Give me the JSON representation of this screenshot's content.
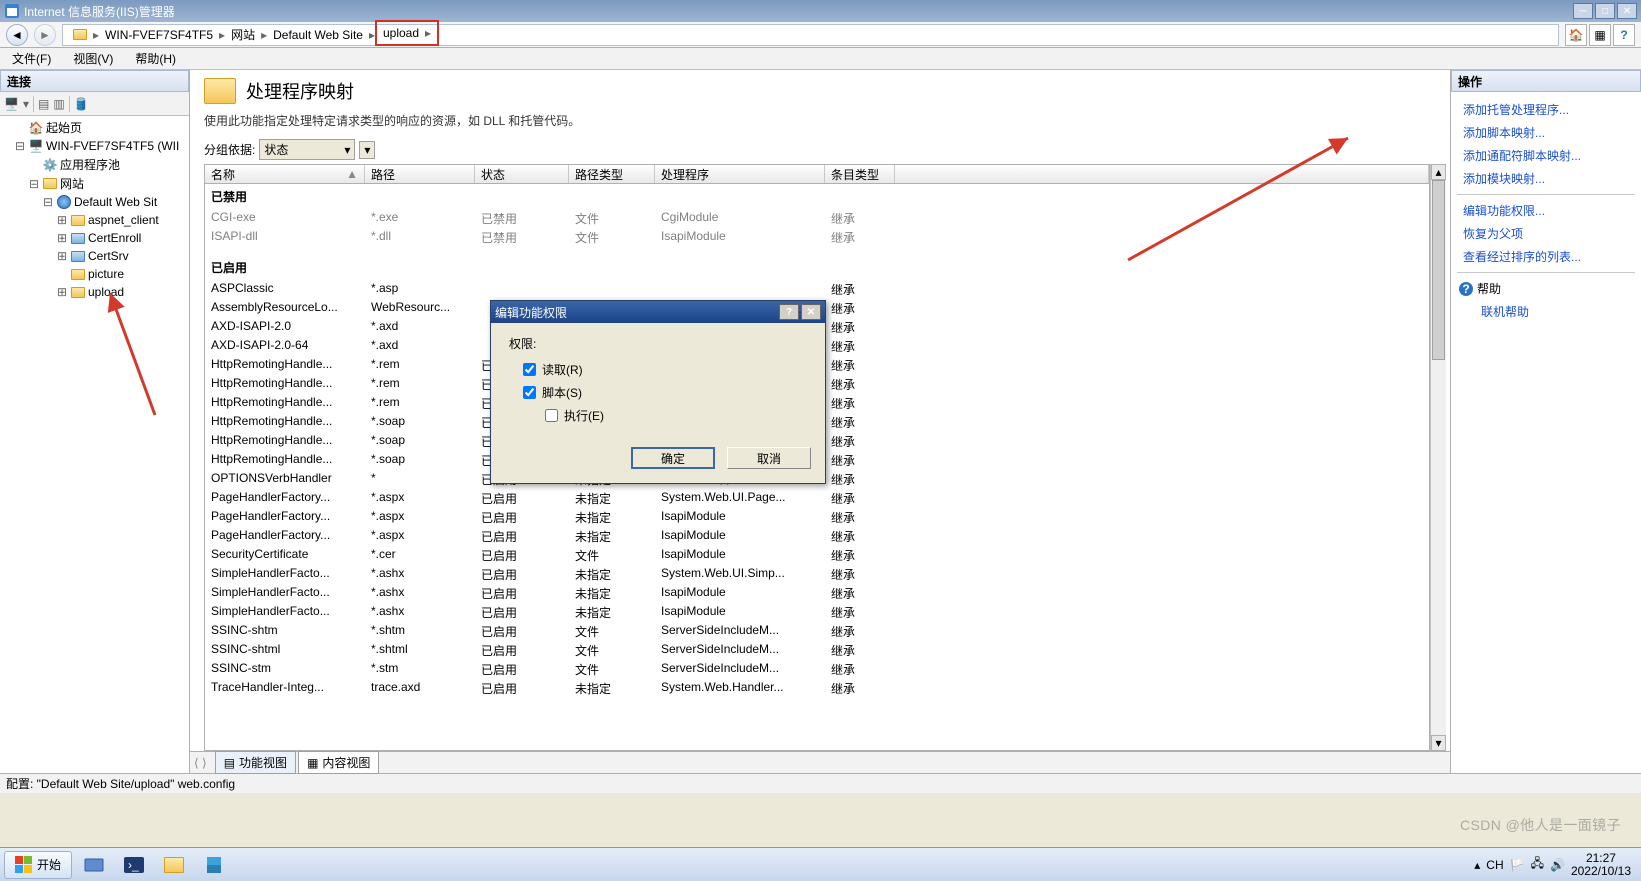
{
  "window": {
    "title": "Internet 信息服务(IIS)管理器"
  },
  "breadcrumb": {
    "items": [
      "WIN-FVEF7SF4TF5",
      "网站",
      "Default Web Site",
      "upload"
    ]
  },
  "menubar": {
    "file": "文件(F)",
    "view": "视图(V)",
    "help": "帮助(H)"
  },
  "connections": {
    "title": "连接",
    "tree": [
      {
        "label": "起始页",
        "ind": 1,
        "icon": "home"
      },
      {
        "label": "WIN-FVEF7SF4TF5 (WII",
        "ind": 1,
        "icon": "server",
        "exp": "-"
      },
      {
        "label": "应用程序池",
        "ind": 2,
        "icon": "pool"
      },
      {
        "label": "网站",
        "ind": 2,
        "icon": "folder",
        "exp": "-"
      },
      {
        "label": "Default Web Sit",
        "ind": 3,
        "icon": "globe",
        "exp": "-"
      },
      {
        "label": "aspnet_client",
        "ind": 4,
        "icon": "folder",
        "exp": "+"
      },
      {
        "label": "CertEnroll",
        "ind": 4,
        "icon": "vdir",
        "exp": "+"
      },
      {
        "label": "CertSrv",
        "ind": 4,
        "icon": "vdir",
        "exp": "+"
      },
      {
        "label": "picture",
        "ind": 4,
        "icon": "folder"
      },
      {
        "label": "upload",
        "ind": 4,
        "icon": "folder",
        "exp": "+"
      }
    ]
  },
  "center": {
    "title": "处理程序映射",
    "subtitle": "使用此功能指定处理特定请求类型的响应的资源，如 DLL 和托管代码。",
    "group_label": "分组依据:",
    "group_value": "状态",
    "columns": [
      "名称",
      "路径",
      "状态",
      "路径类型",
      "处理程序",
      "条目类型"
    ],
    "groups": [
      {
        "label": "已禁用",
        "disabled": true,
        "rows": [
          [
            "CGI-exe",
            "*.exe",
            "已禁用",
            "文件",
            "CgiModule",
            "继承"
          ],
          [
            "ISAPI-dll",
            "*.dll",
            "已禁用",
            "文件",
            "IsapiModule",
            "继承"
          ]
        ]
      },
      {
        "label": "已启用",
        "disabled": false,
        "rows": [
          [
            "ASPClassic",
            "*.asp",
            "",
            "",
            "",
            "继承"
          ],
          [
            "AssemblyResourceLo...",
            "WebResourc...",
            "",
            "",
            "",
            "继承"
          ],
          [
            "AXD-ISAPI-2.0",
            "*.axd",
            "",
            "",
            "",
            "继承"
          ],
          [
            "AXD-ISAPI-2.0-64",
            "*.axd",
            "",
            "",
            "",
            "继承"
          ],
          [
            "HttpRemotingHandle...",
            "*.rem",
            "已",
            "",
            "",
            "继承"
          ],
          [
            "HttpRemotingHandle...",
            "*.rem",
            "已",
            "",
            "",
            "继承"
          ],
          [
            "HttpRemotingHandle...",
            "*.rem",
            "已",
            "",
            "",
            "继承"
          ],
          [
            "HttpRemotingHandle...",
            "*.soap",
            "已",
            "",
            "",
            "继承"
          ],
          [
            "HttpRemotingHandle...",
            "*.soap",
            "已",
            "",
            "",
            "继承"
          ],
          [
            "HttpRemotingHandle...",
            "*.soap",
            "已",
            "",
            "",
            "继承"
          ],
          [
            "OPTIONSVerbHandler",
            "*",
            "已启用",
            "未指定",
            "ProtocolSupportModule",
            "继承"
          ],
          [
            "PageHandlerFactory...",
            "*.aspx",
            "已启用",
            "未指定",
            "System.Web.UI.Page...",
            "继承"
          ],
          [
            "PageHandlerFactory...",
            "*.aspx",
            "已启用",
            "未指定",
            "IsapiModule",
            "继承"
          ],
          [
            "PageHandlerFactory...",
            "*.aspx",
            "已启用",
            "未指定",
            "IsapiModule",
            "继承"
          ],
          [
            "SecurityCertificate",
            "*.cer",
            "已启用",
            "文件",
            "IsapiModule",
            "继承"
          ],
          [
            "SimpleHandlerFacto...",
            "*.ashx",
            "已启用",
            "未指定",
            "System.Web.UI.Simp...",
            "继承"
          ],
          [
            "SimpleHandlerFacto...",
            "*.ashx",
            "已启用",
            "未指定",
            "IsapiModule",
            "继承"
          ],
          [
            "SimpleHandlerFacto...",
            "*.ashx",
            "已启用",
            "未指定",
            "IsapiModule",
            "继承"
          ],
          [
            "SSINC-shtm",
            "*.shtm",
            "已启用",
            "文件",
            "ServerSideIncludeM...",
            "继承"
          ],
          [
            "SSINC-shtml",
            "*.shtml",
            "已启用",
            "文件",
            "ServerSideIncludeM...",
            "继承"
          ],
          [
            "SSINC-stm",
            "*.stm",
            "已启用",
            "文件",
            "ServerSideIncludeM...",
            "继承"
          ],
          [
            "TraceHandler-Integ...",
            "trace.axd",
            "已启用",
            "未指定",
            "System.Web.Handler...",
            "继承"
          ]
        ]
      }
    ],
    "tabs": {
      "features": "功能视图",
      "content": "内容视图"
    }
  },
  "actions": {
    "title": "操作",
    "links": [
      "添加托管处理程序...",
      "添加脚本映射...",
      "添加通配符脚本映射...",
      "添加模块映射..."
    ],
    "links2": [
      "编辑功能权限...",
      "恢复为父项",
      "查看经过排序的列表..."
    ],
    "help": "帮助",
    "onlinehelp": "联机帮助"
  },
  "dialog": {
    "title": "编辑功能权限",
    "perm_label": "权限:",
    "read": "读取(R)",
    "script": "脚本(S)",
    "exec": "执行(E)",
    "ok": "确定",
    "cancel": "取消"
  },
  "statusbar": {
    "text": "配置: \"Default Web Site/upload\" web.config"
  },
  "taskbar": {
    "start": "开始",
    "ime": "CH",
    "time": "21:27",
    "date": "2022/10/13"
  },
  "watermark": "CSDN @他人是一面镜子"
}
